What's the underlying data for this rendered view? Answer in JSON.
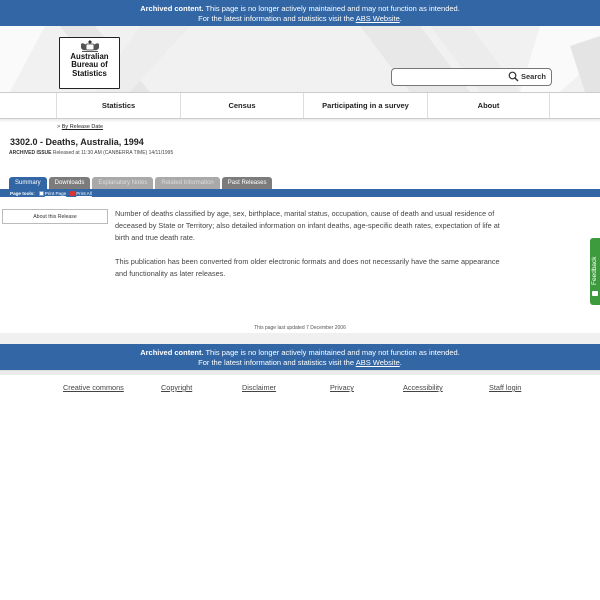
{
  "archive_banner": {
    "bold": "Archived content.",
    "text": " This page is no longer actively maintained and may not function as intended.",
    "line2_prefix": "For the latest information and statistics visit the ",
    "link": "ABS Website",
    "line2_suffix": "."
  },
  "logo": {
    "line1": "Australian",
    "line2": "Bureau of",
    "line3": "Statistics"
  },
  "search": {
    "placeholder": "",
    "button_label": "Search"
  },
  "nav": {
    "items": [
      "Statistics",
      "Census",
      "Participating in a survey",
      "About"
    ]
  },
  "breadcrumb": {
    "prefix": ">",
    "link": "By Release Date"
  },
  "page": {
    "title": "3302.0 - Deaths, Australia, 1994",
    "issue_label": "ARCHIVED ISSUE",
    "issue_text": "Released at 11:30 AM (CANBERRA TIME) 14/11/1995"
  },
  "tabs": [
    "Summary",
    "Downloads",
    "Explanatory Notes",
    "Related Information",
    "Past Releases"
  ],
  "page_tools": {
    "label": "Page tools:",
    "print_page": "Print Page",
    "print_all": "Print All"
  },
  "sidebar": {
    "about_label": "About this Release"
  },
  "content": {
    "para1": "Number of deaths classified by age, sex, birthplace, marital status, occupation, cause of death and usual residence of deceased by State or Territory; also detailed information on infant deaths, age-specific death rates, expectation of life at birth and true death rate.",
    "para2": "This publication has been converted from older electronic formats and does not necessarily have the same appearance and functionality as later releases."
  },
  "feedback": {
    "label": "Feedback"
  },
  "updated": "This page last updated 7 December 2006",
  "footer": {
    "links": [
      "Creative commons",
      "Copyright",
      "Disclaimer",
      "Privacy",
      "Accessibility",
      "Staff login"
    ]
  },
  "colors": {
    "banner_blue": "#3266a4",
    "feedback_green": "#3d9a3d",
    "tab_grey": "#7c7c7c"
  },
  "icons": [
    "crest-icon",
    "search-icon",
    "print-page-icon",
    "print-all-icon",
    "feedback-icon"
  ]
}
